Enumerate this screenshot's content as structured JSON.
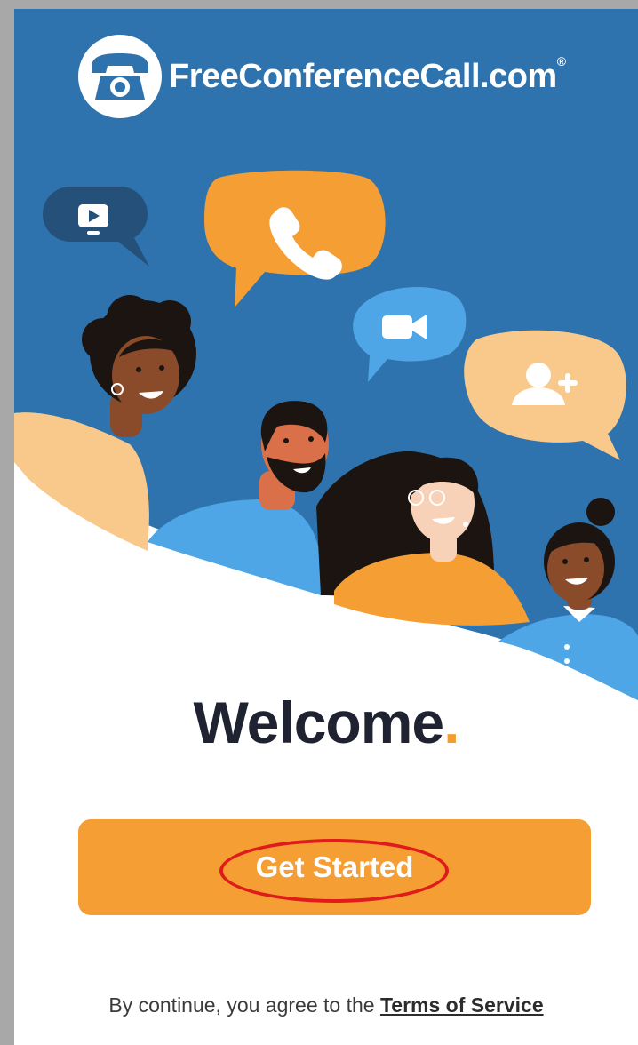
{
  "brand": {
    "name": "FreeConferenceCall.com",
    "registered_mark": "®"
  },
  "hero": {
    "bubbles": [
      "video-play-icon",
      "phone-icon",
      "video-camera-icon",
      "add-user-icon"
    ],
    "colors": {
      "background": "#2e73ad",
      "orange": "#f49e34",
      "light_blue": "#4ea6e6",
      "peach": "#f8c98a",
      "navy": "#24507a"
    }
  },
  "welcome": {
    "title": "Welcome",
    "dot": "."
  },
  "cta": {
    "label": "Get Started",
    "color": "#f49e34",
    "highlight_color": "#e01b1b"
  },
  "terms": {
    "prefix": "By continue, you agree to the ",
    "link": "Terms of Service"
  }
}
